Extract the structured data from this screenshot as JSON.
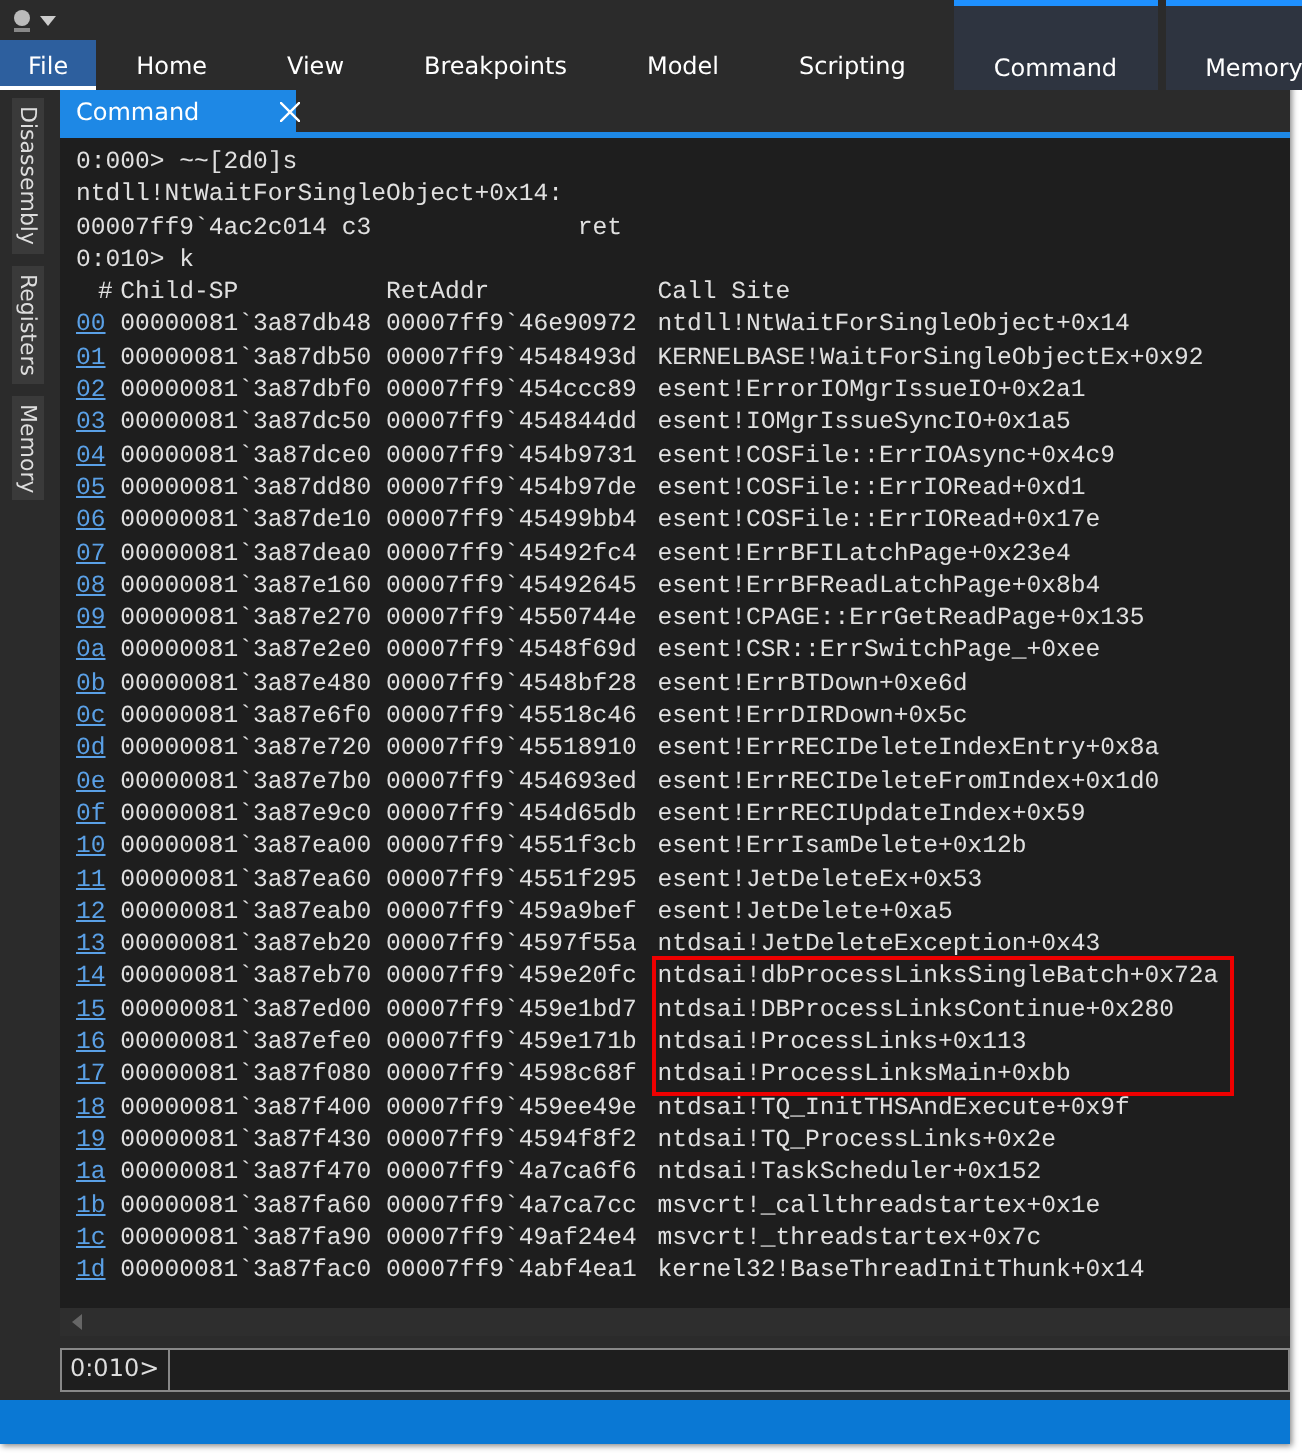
{
  "ribbon": {
    "tabs": [
      {
        "label": "File",
        "kind": "file",
        "selected": true
      },
      {
        "label": "Home",
        "kind": "tab",
        "selected": false
      },
      {
        "label": "View",
        "kind": "tab",
        "selected": false
      },
      {
        "label": "Breakpoints",
        "kind": "tab",
        "selected": false
      },
      {
        "label": "Model",
        "kind": "tab",
        "selected": false
      },
      {
        "label": "Scripting",
        "kind": "tab",
        "selected": false
      },
      {
        "label": "Command",
        "kind": "context",
        "selected": false
      },
      {
        "label": "Memory",
        "kind": "context",
        "selected": false
      }
    ]
  },
  "side_tabs": [
    {
      "label": "Disassembly"
    },
    {
      "label": "Registers"
    },
    {
      "label": "Memory"
    }
  ],
  "panel": {
    "title": "Command",
    "output": [
      "0:000> ~~[2d0]s",
      "ntdll!NtWaitForSingleObject+0x14:",
      "00007ff9`4ac2c014 c3              ret",
      "0:010> k"
    ],
    "table": {
      "columns": [
        "#",
        "Child-SP",
        "RetAddr",
        "Call Site"
      ],
      "rows": [
        {
          "frame": "00",
          "child_sp": "00000081`3a87db48",
          "ret_addr": "00007ff9`46e90972",
          "call_site": "ntdll!NtWaitForSingleObject+0x14",
          "highlighted": false
        },
        {
          "frame": "01",
          "child_sp": "00000081`3a87db50",
          "ret_addr": "00007ff9`4548493d",
          "call_site": "KERNELBASE!WaitForSingleObjectEx+0x92",
          "highlighted": false
        },
        {
          "frame": "02",
          "child_sp": "00000081`3a87dbf0",
          "ret_addr": "00007ff9`454ccc89",
          "call_site": "esent!ErrorIOMgrIssueIO+0x2a1",
          "highlighted": false
        },
        {
          "frame": "03",
          "child_sp": "00000081`3a87dc50",
          "ret_addr": "00007ff9`454844dd",
          "call_site": "esent!IOMgrIssueSyncIO+0x1a5",
          "highlighted": false
        },
        {
          "frame": "04",
          "child_sp": "00000081`3a87dce0",
          "ret_addr": "00007ff9`454b9731",
          "call_site": "esent!COSFile::ErrIOAsync+0x4c9",
          "highlighted": false
        },
        {
          "frame": "05",
          "child_sp": "00000081`3a87dd80",
          "ret_addr": "00007ff9`454b97de",
          "call_site": "esent!COSFile::ErrIORead+0xd1",
          "highlighted": false
        },
        {
          "frame": "06",
          "child_sp": "00000081`3a87de10",
          "ret_addr": "00007ff9`45499bb4",
          "call_site": "esent!COSFile::ErrIORead+0x17e",
          "highlighted": false
        },
        {
          "frame": "07",
          "child_sp": "00000081`3a87dea0",
          "ret_addr": "00007ff9`45492fc4",
          "call_site": "esent!ErrBFILatchPage+0x23e4",
          "highlighted": false
        },
        {
          "frame": "08",
          "child_sp": "00000081`3a87e160",
          "ret_addr": "00007ff9`45492645",
          "call_site": "esent!ErrBFReadLatchPage+0x8b4",
          "highlighted": false
        },
        {
          "frame": "09",
          "child_sp": "00000081`3a87e270",
          "ret_addr": "00007ff9`4550744e",
          "call_site": "esent!CPAGE::ErrGetReadPage+0x135",
          "highlighted": false
        },
        {
          "frame": "0a",
          "child_sp": "00000081`3a87e2e0",
          "ret_addr": "00007ff9`4548f69d",
          "call_site": "esent!CSR::ErrSwitchPage_+0xee",
          "highlighted": false
        },
        {
          "frame": "0b",
          "child_sp": "00000081`3a87e480",
          "ret_addr": "00007ff9`4548bf28",
          "call_site": "esent!ErrBTDown+0xe6d",
          "highlighted": false
        },
        {
          "frame": "0c",
          "child_sp": "00000081`3a87e6f0",
          "ret_addr": "00007ff9`45518c46",
          "call_site": "esent!ErrDIRDown+0x5c",
          "highlighted": false
        },
        {
          "frame": "0d",
          "child_sp": "00000081`3a87e720",
          "ret_addr": "00007ff9`45518910",
          "call_site": "esent!ErrRECIDeleteIndexEntry+0x8a",
          "highlighted": false
        },
        {
          "frame": "0e",
          "child_sp": "00000081`3a87e7b0",
          "ret_addr": "00007ff9`454693ed",
          "call_site": "esent!ErrRECIDeleteFromIndex+0x1d0",
          "highlighted": false
        },
        {
          "frame": "0f",
          "child_sp": "00000081`3a87e9c0",
          "ret_addr": "00007ff9`454d65db",
          "call_site": "esent!ErrRECIUpdateIndex+0x59",
          "highlighted": false
        },
        {
          "frame": "10",
          "child_sp": "00000081`3a87ea00",
          "ret_addr": "00007ff9`4551f3cb",
          "call_site": "esent!ErrIsamDelete+0x12b",
          "highlighted": false
        },
        {
          "frame": "11",
          "child_sp": "00000081`3a87ea60",
          "ret_addr": "00007ff9`4551f295",
          "call_site": "esent!JetDeleteEx+0x53",
          "highlighted": false
        },
        {
          "frame": "12",
          "child_sp": "00000081`3a87eab0",
          "ret_addr": "00007ff9`459a9bef",
          "call_site": "esent!JetDelete+0xa5",
          "highlighted": false
        },
        {
          "frame": "13",
          "child_sp": "00000081`3a87eb20",
          "ret_addr": "00007ff9`4597f55a",
          "call_site": "ntdsai!JetDeleteException+0x43",
          "highlighted": false
        },
        {
          "frame": "14",
          "child_sp": "00000081`3a87eb70",
          "ret_addr": "00007ff9`459e20fc",
          "call_site": "ntdsai!dbProcessLinksSingleBatch+0x72a",
          "highlighted": true
        },
        {
          "frame": "15",
          "child_sp": "00000081`3a87ed00",
          "ret_addr": "00007ff9`459e1bd7",
          "call_site": "ntdsai!DBProcessLinksContinue+0x280",
          "highlighted": true
        },
        {
          "frame": "16",
          "child_sp": "00000081`3a87efe0",
          "ret_addr": "00007ff9`459e171b",
          "call_site": "ntdsai!ProcessLinks+0x113",
          "highlighted": true
        },
        {
          "frame": "17",
          "child_sp": "00000081`3a87f080",
          "ret_addr": "00007ff9`4598c68f",
          "call_site": "ntdsai!ProcessLinksMain+0xbb",
          "highlighted": true
        },
        {
          "frame": "18",
          "child_sp": "00000081`3a87f400",
          "ret_addr": "00007ff9`459ee49e",
          "call_site": "ntdsai!TQ_InitTHSAndExecute+0x9f",
          "highlighted": false
        },
        {
          "frame": "19",
          "child_sp": "00000081`3a87f430",
          "ret_addr": "00007ff9`4594f8f2",
          "call_site": "ntdsai!TQ_ProcessLinks+0x2e",
          "highlighted": false
        },
        {
          "frame": "1a",
          "child_sp": "00000081`3a87f470",
          "ret_addr": "00007ff9`4a7ca6f6",
          "call_site": "ntdsai!TaskScheduler+0x152",
          "highlighted": false
        },
        {
          "frame": "1b",
          "child_sp": "00000081`3a87fa60",
          "ret_addr": "00007ff9`4a7ca7cc",
          "call_site": "msvcrt!_callthreadstartex+0x1e",
          "highlighted": false
        },
        {
          "frame": "1c",
          "child_sp": "00000081`3a87fa90",
          "ret_addr": "00007ff9`49af24e4",
          "call_site": "msvcrt!_threadstartex+0x7c",
          "highlighted": false
        },
        {
          "frame": "1d",
          "child_sp": "00000081`3a87fac0",
          "ret_addr": "00007ff9`4abf4ea1",
          "call_site": "kernel32!BaseThreadInitThunk+0x14",
          "highlighted": false
        }
      ]
    },
    "prompt": "0:010>"
  }
}
